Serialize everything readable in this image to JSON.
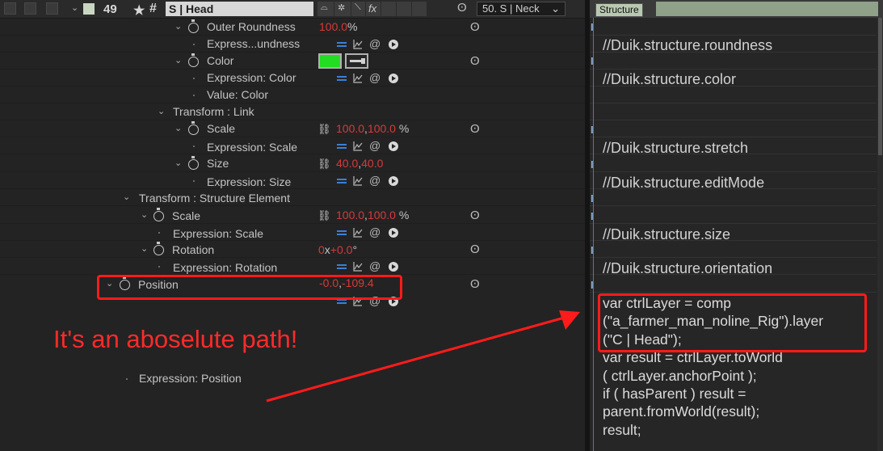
{
  "layer": {
    "number": "49",
    "name": "S | Head",
    "parent": "50. S | Neck",
    "color": "#c9d7c2"
  },
  "properties": {
    "outer_roundness": "Outer Roundness",
    "outer_roundness_value": "100.0",
    "outer_roundness_unit": "%",
    "expr_undness": "Express...undness",
    "color": "Color",
    "color_value": "#22dd22",
    "expression_color": "Expression: Color",
    "value_color": "Value: Color",
    "transform_link": "Transform : Link",
    "scale": "Scale",
    "scale_value_x": "100.0",
    "scale_value_y": "100.0",
    "scale_unit": "%",
    "expression_scale": "Expression: Scale",
    "size": "Size",
    "size_value_x": "40.0",
    "size_value_y": "40.0",
    "expression_size": "Expression: Size",
    "transform_structure": "Transform : Structure Element",
    "scale2": "Scale",
    "scale2_value_x": "100.0",
    "scale2_value_y": "100.0",
    "scale2_unit": "%",
    "expression_scale2": "Expression: Scale",
    "rotation": "Rotation",
    "rotation_rev": "0",
    "rotation_x": "x",
    "rotation_deg": "+0.0",
    "rotation_unit": "°",
    "expression_rotation": "Expression: Rotation",
    "position": "Position",
    "position_x": "-0.0",
    "position_y": "-109.4",
    "expression_position": "Expression: Position",
    "value_sep": ","
  },
  "timeline": {
    "bar_label": "Structure",
    "expr_roundness": "//Duik.structure.roundness",
    "expr_color": "//Duik.structure.color",
    "expr_stretch": "//Duik.structure.stretch",
    "expr_editmode": "//Duik.structure.editMode",
    "expr_size": "//Duik.structure.size",
    "expr_orientation": "//Duik.structure.orientation",
    "code": [
      "var ctrlLayer = comp",
      "(\"a_farmer_man_noline_Rig\").layer",
      "(\"C | Head\");",
      "var result = ctrlLayer.toWorld",
      "( ctrlLayer.anchorPoint );",
      "if ( hasParent ) result =",
      "parent.fromWorld(result);",
      "result;"
    ]
  },
  "annotation": {
    "note": "It's an aboselute path!",
    "color": "#ff1b1b"
  },
  "icons": [
    "star-icon",
    "hash-icon",
    "stopwatch-icon",
    "link-icon",
    "equals-icon",
    "graph-icon",
    "pickwhip-icon",
    "play-icon",
    "spiral-icon",
    "dropdown-icon"
  ]
}
